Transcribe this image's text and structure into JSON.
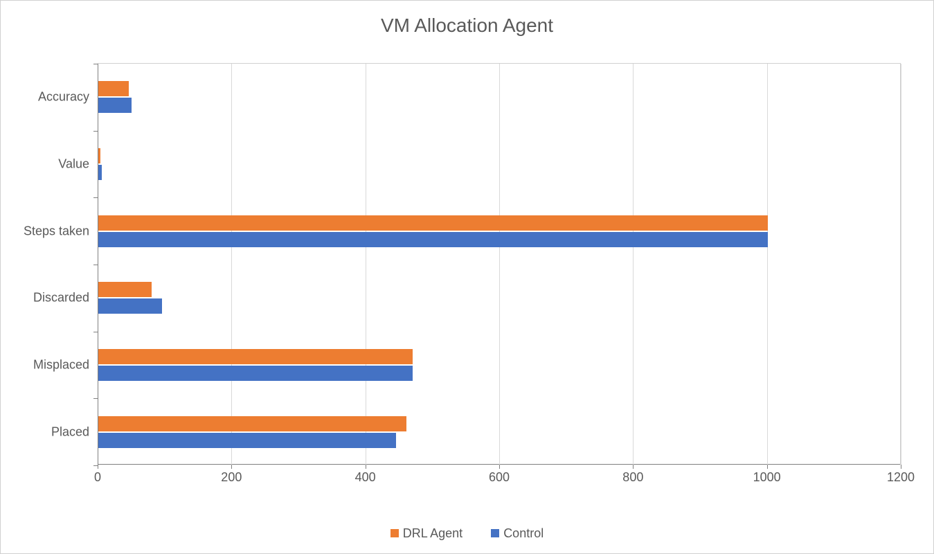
{
  "chart_data": {
    "type": "bar",
    "orientation": "horizontal",
    "title": "VM Allocation Agent",
    "categories": [
      "Placed",
      "Misplaced",
      "Discarded",
      "Steps taken",
      "Value",
      "Accuracy"
    ],
    "series": [
      {
        "name": "DRL Agent",
        "color": "#ed7d31",
        "values": [
          460,
          470,
          80,
          1000,
          3,
          45
        ]
      },
      {
        "name": "Control",
        "color": "#4472c4",
        "values": [
          445,
          470,
          95,
          1000,
          5,
          50
        ]
      }
    ],
    "xlabel": "",
    "ylabel": "",
    "xlim": [
      0,
      1200
    ],
    "x_ticks": [
      0,
      200,
      400,
      600,
      800,
      1000,
      1200
    ],
    "legend_position": "bottom",
    "grid": true
  }
}
